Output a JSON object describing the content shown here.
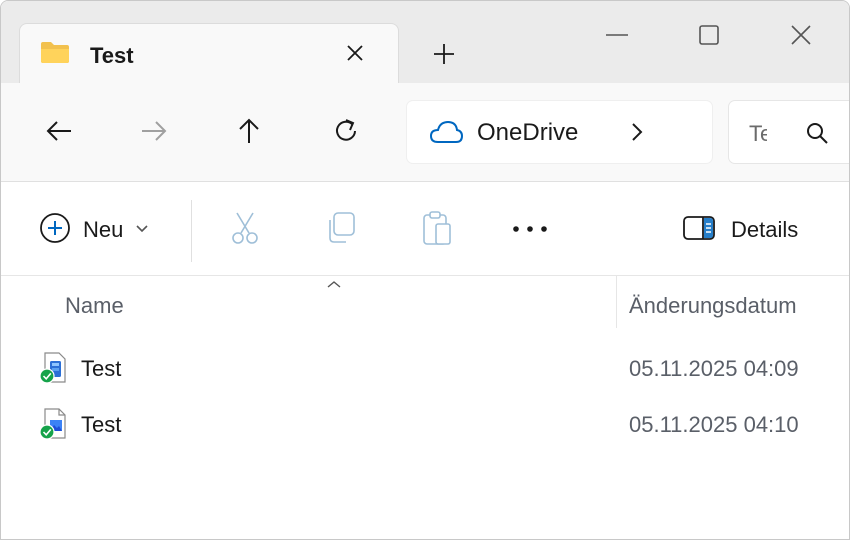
{
  "titlebar": {
    "tab_title": "Test",
    "icons": {
      "folder": "folder-icon",
      "close": "close-icon",
      "new_tab": "plus-icon",
      "minimize": "minimize-icon",
      "maximize": "maximize-icon",
      "window_close": "close-icon"
    }
  },
  "nav": {
    "address_label": "OneDrive",
    "search_placeholder": "Te",
    "icons": {
      "back": "arrow-left-icon",
      "forward": "arrow-right-icon",
      "up": "arrow-up-icon",
      "refresh": "refresh-icon",
      "cloud": "cloud-icon",
      "chevron": "chevron-right-icon",
      "search": "search-icon"
    }
  },
  "toolbar": {
    "new_label": "Neu",
    "details_label": "Details",
    "icons": {
      "new": "plus-circle-icon",
      "cut": "scissors-icon",
      "copy": "copy-icon",
      "paste": "clipboard-icon",
      "more": "more-horizontal-icon",
      "details": "details-pane-icon"
    }
  },
  "columns": {
    "name": "Name",
    "date": "Änderungsdatum"
  },
  "files": [
    {
      "name": "Test",
      "date": "05.11.2025 04:09",
      "icon": "document-file-icon",
      "status": "synced"
    },
    {
      "name": "Test",
      "date": "05.11.2025 04:10",
      "icon": "image-file-icon",
      "status": "synced"
    }
  ],
  "colors": {
    "accent": "#0067c0",
    "synced": "#16a34a",
    "disabled": "#9fbfd8"
  }
}
